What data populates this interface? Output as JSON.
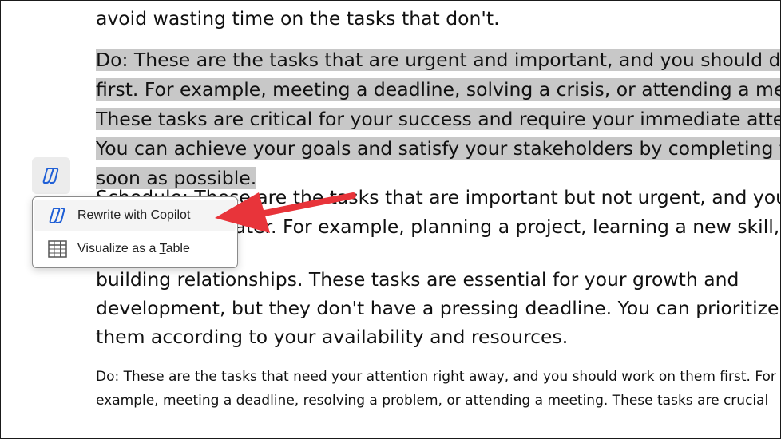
{
  "document": {
    "lines": [
      "avoid wasting time on the tasks that don't.",
      "Do: These are the tasks that are urgent and important, and you should do them",
      "first. For example, meeting a deadline, solving a crisis, or attending a meeting.",
      "These tasks are critical for your success and require your immediate attention.",
      "You can achieve your goals and satisfy your stakeholders by completing them as",
      "soon as possible.",
      "Schedule: These are the tasks that are important but not urgent, and you should",
      "plan them for later. For example, planning a project, learning a new skill, or",
      "building relationships. These tasks are essential for your growth and",
      "development, but they don't have a pressing deadline. You can prioritize and",
      "them according to your availability and resources."
    ],
    "rewritten_lines": [
      "Do: These are the tasks that need your attention right away, and you should work on them first. For",
      "example, meeting a deadline, resolving a problem, or attending a meeting. These tasks are crucial"
    ]
  },
  "copilot_button": {
    "icon": "copilot-icon"
  },
  "context_menu": {
    "items": [
      {
        "label": "Rewrite with Copilot",
        "icon": "copilot-icon"
      },
      {
        "label_before": "Visualize as a ",
        "label_accel": "T",
        "label_after": "able",
        "icon": "table-icon"
      }
    ]
  },
  "annotation": {
    "arrow_color": "#e8343a"
  },
  "colors": {
    "selection": "#c8c8c8"
  }
}
